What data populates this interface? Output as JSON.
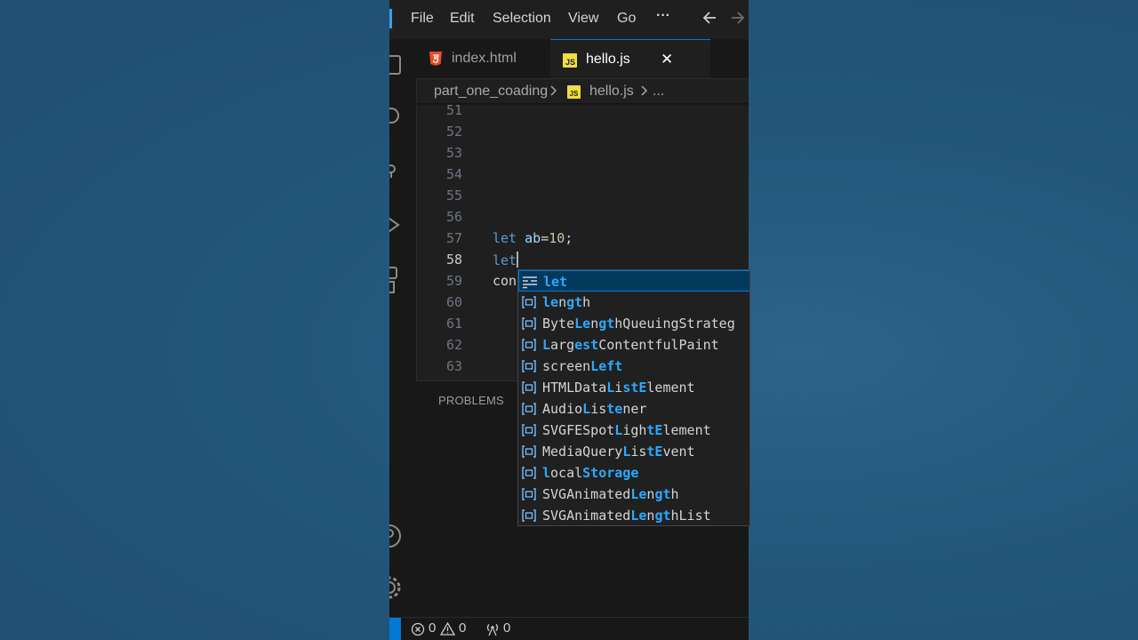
{
  "menu": [
    "File",
    "Edit",
    "Selection",
    "View",
    "Go",
    "···"
  ],
  "tabs": [
    {
      "label": "index.html",
      "icon": "html5-icon",
      "active": false
    },
    {
      "label": "hello.js",
      "icon": "javascript-icon",
      "active": true,
      "close": "✕"
    }
  ],
  "breadcrumb": {
    "folder": "part_one_coading",
    "file": "hello.js",
    "more": "..."
  },
  "editor": {
    "line_numbers": [
      "51",
      "52",
      "53",
      "54",
      "55",
      "56",
      "57",
      "58",
      "59",
      "60",
      "61",
      "62",
      "63"
    ],
    "current_line": "58",
    "lines": {
      "57": {
        "keyword": "let",
        "rest_ident": "ab",
        "rest_op": "=",
        "rest_num": "10",
        "rest_end": ";"
      },
      "58": {
        "keyword": "let"
      },
      "59": {
        "text": "con"
      }
    }
  },
  "panel": {
    "tab": "PROBLEMS"
  },
  "status": {
    "errors": "0",
    "warnings": "0",
    "ports": "0"
  },
  "suggest": {
    "items": [
      {
        "parts": [
          {
            "t": "let",
            "h": true
          }
        ],
        "kind": "keyword",
        "selected": true
      },
      {
        "parts": [
          {
            "t": "le",
            "h": true
          },
          {
            "t": "n",
            "h": false
          },
          {
            "t": "gt",
            "h": true
          },
          {
            "t": "h",
            "h": false
          }
        ],
        "kind": "variable"
      },
      {
        "parts": [
          {
            "t": "Byte",
            "h": false
          },
          {
            "t": "Le",
            "h": true
          },
          {
            "t": "n",
            "h": false
          },
          {
            "t": "gt",
            "h": true
          },
          {
            "t": "hQueuingStrateg",
            "h": false
          }
        ],
        "kind": "variable"
      },
      {
        "parts": [
          {
            "t": "L",
            "h": true
          },
          {
            "t": "arg",
            "h": false
          },
          {
            "t": "est",
            "h": true
          },
          {
            "t": "ContentfulPaint",
            "h": false
          }
        ],
        "kind": "variable"
      },
      {
        "parts": [
          {
            "t": "screen",
            "h": false
          },
          {
            "t": "Left",
            "h": true
          }
        ],
        "kind": "variable"
      },
      {
        "parts": [
          {
            "t": "HTMLData",
            "h": false
          },
          {
            "t": "L",
            "h": true
          },
          {
            "t": "i",
            "h": false
          },
          {
            "t": "st",
            "h": true
          },
          {
            "t": "E",
            "h": true
          },
          {
            "t": "lement",
            "h": false
          }
        ],
        "kind": "variable"
      },
      {
        "parts": [
          {
            "t": "Audio",
            "h": false
          },
          {
            "t": "L",
            "h": true
          },
          {
            "t": "is",
            "h": false
          },
          {
            "t": "te",
            "h": true
          },
          {
            "t": "ner",
            "h": false
          }
        ],
        "kind": "variable"
      },
      {
        "parts": [
          {
            "t": "SVGFESpot",
            "h": false
          },
          {
            "t": "L",
            "h": true
          },
          {
            "t": "igh",
            "h": false
          },
          {
            "t": "tE",
            "h": true
          },
          {
            "t": "lement",
            "h": false
          }
        ],
        "kind": "variable"
      },
      {
        "parts": [
          {
            "t": "MediaQuery",
            "h": false
          },
          {
            "t": "L",
            "h": true
          },
          {
            "t": "is",
            "h": false
          },
          {
            "t": "tE",
            "h": true
          },
          {
            "t": "vent",
            "h": false
          }
        ],
        "kind": "variable"
      },
      {
        "parts": [
          {
            "t": "l",
            "h": true
          },
          {
            "t": "ocal",
            "h": false
          },
          {
            "t": "St",
            "h": true
          },
          {
            "t": "orage",
            "h": true
          }
        ],
        "kind": "variable"
      },
      {
        "parts": [
          {
            "t": "SVGAnimated",
            "h": false
          },
          {
            "t": "Le",
            "h": true
          },
          {
            "t": "n",
            "h": false
          },
          {
            "t": "gt",
            "h": true
          },
          {
            "t": "h",
            "h": false
          }
        ],
        "kind": "variable"
      },
      {
        "parts": [
          {
            "t": "SVGAnimated",
            "h": false
          },
          {
            "t": "Le",
            "h": true
          },
          {
            "t": "n",
            "h": false
          },
          {
            "t": "gt",
            "h": true
          },
          {
            "t": "hList",
            "h": false
          }
        ],
        "kind": "variable"
      }
    ]
  }
}
